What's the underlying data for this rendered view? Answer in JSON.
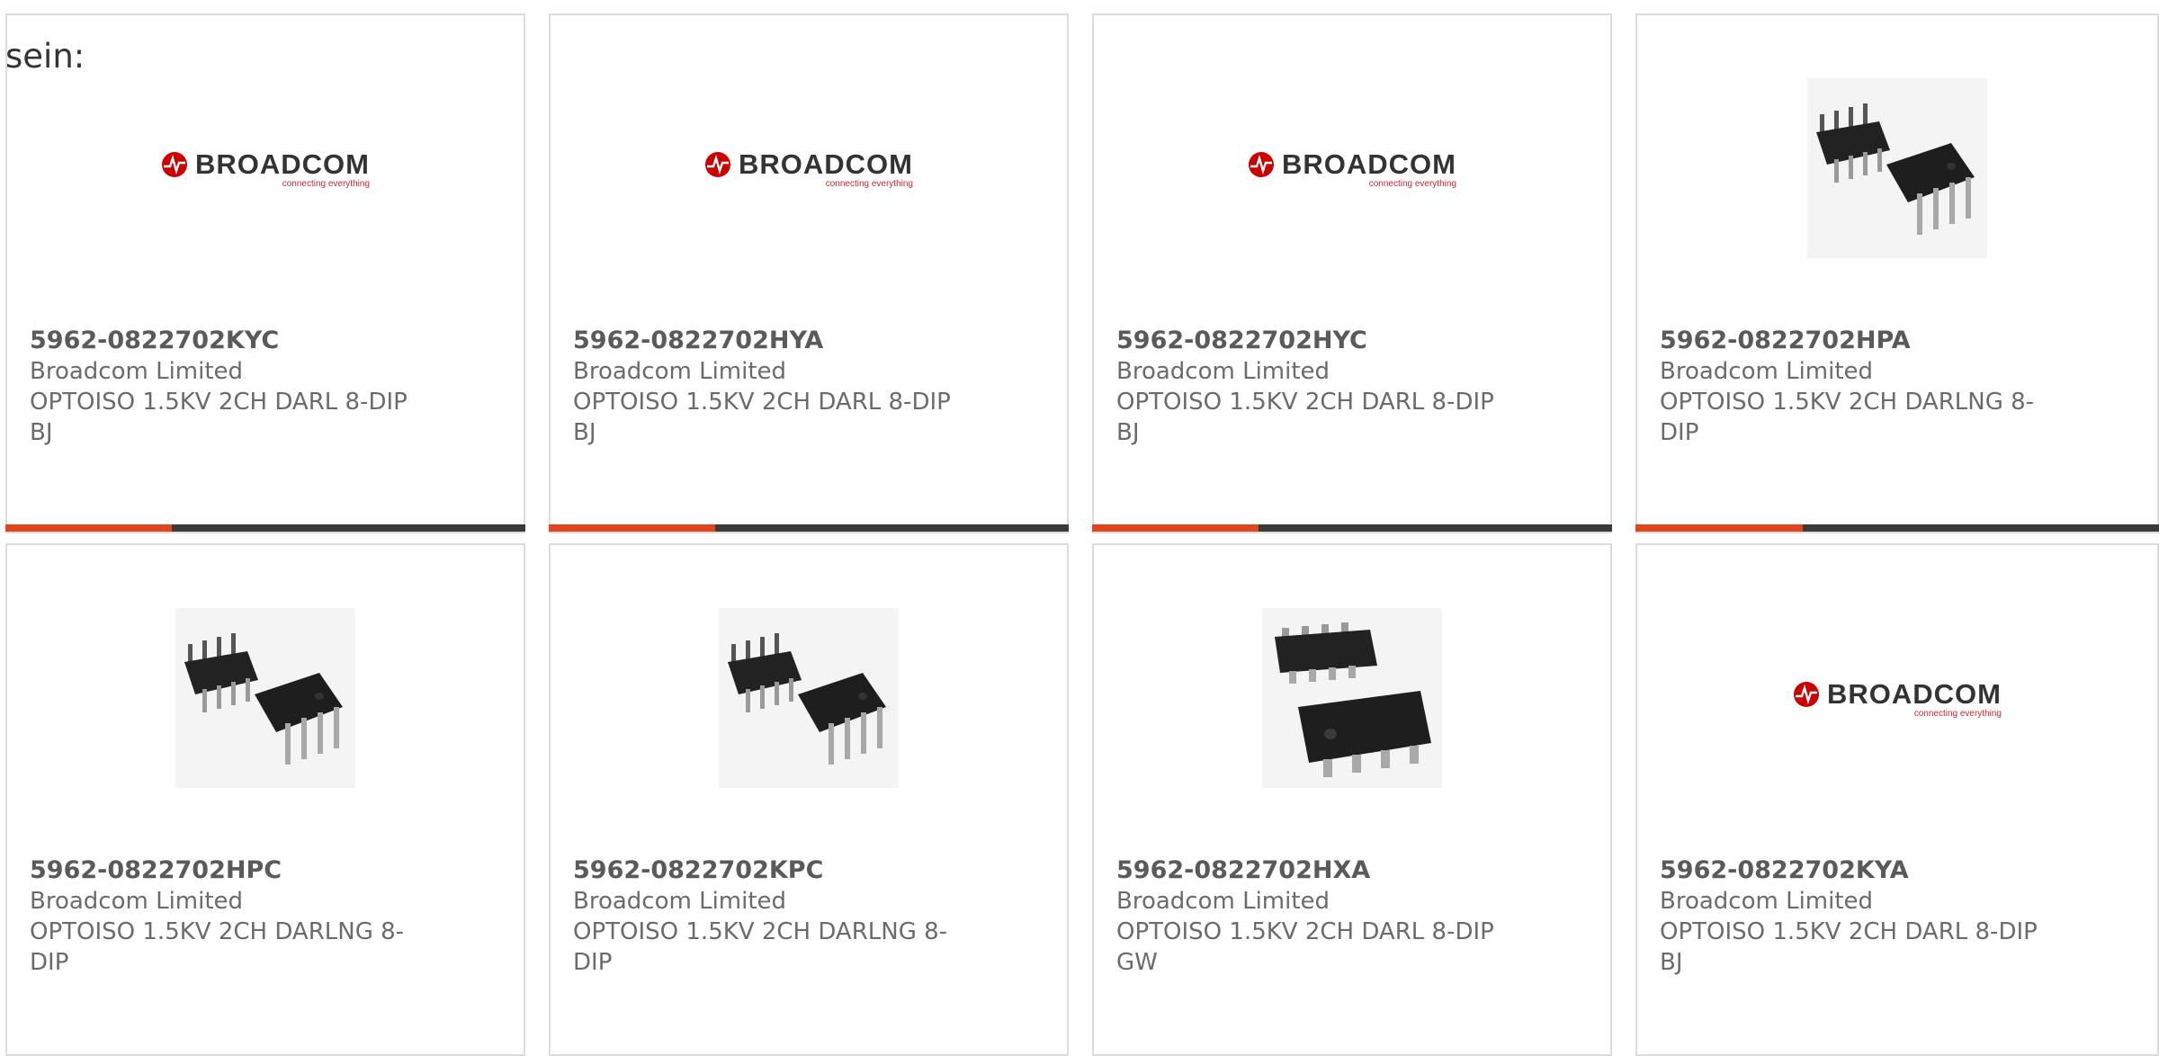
{
  "intro_text": "sein:",
  "brand": {
    "logo_word": "BROADCOM",
    "logo_tagline": "connecting everything",
    "accent_color": "#e2441b",
    "logo_red": "#cc0000"
  },
  "cards": [
    {
      "part": "5962-0822702KYC",
      "maker": "Broadcom Limited",
      "desc1": "OPTOISO 1.5KV 2CH DARL 8-DIP",
      "desc2": "BJ",
      "image": "broadcom-logo",
      "progress": 0.32
    },
    {
      "part": "5962-0822702HYA",
      "maker": "Broadcom Limited",
      "desc1": "OPTOISO 1.5KV 2CH DARL 8-DIP",
      "desc2": "BJ",
      "image": "broadcom-logo",
      "progress": 0.32
    },
    {
      "part": "5962-0822702HYC",
      "maker": "Broadcom Limited",
      "desc1": "OPTOISO 1.5KV 2CH DARL 8-DIP",
      "desc2": "BJ",
      "image": "broadcom-logo",
      "progress": 0.32
    },
    {
      "part": "5962-0822702HPA",
      "maker": "Broadcom Limited",
      "desc1": "OPTOISO 1.5KV 2CH DARLNG 8-",
      "desc2": "DIP",
      "image": "dip-chip-photo",
      "progress": 0.32
    },
    {
      "part": "5962-0822702HPC",
      "maker": "Broadcom Limited",
      "desc1": "OPTOISO 1.5KV 2CH DARLNG 8-",
      "desc2": "DIP",
      "image": "dip-chip-photo"
    },
    {
      "part": "5962-0822702KPC",
      "maker": "Broadcom Limited",
      "desc1": "OPTOISO 1.5KV 2CH DARLNG 8-",
      "desc2": "DIP",
      "image": "dip-chip-photo"
    },
    {
      "part": "5962-0822702HXA",
      "maker": "Broadcom Limited",
      "desc1": "OPTOISO 1.5KV 2CH DARL 8-DIP",
      "desc2": "GW",
      "image": "gullwing-chip-photo"
    },
    {
      "part": "5962-0822702KYA",
      "maker": "Broadcom Limited",
      "desc1": "OPTOISO 1.5KV 2CH DARL 8-DIP",
      "desc2": "BJ",
      "image": "broadcom-logo"
    }
  ]
}
